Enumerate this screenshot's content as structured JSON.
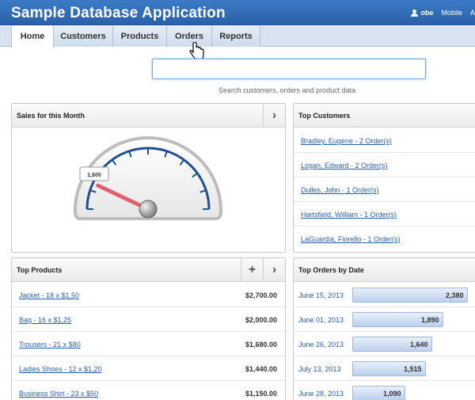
{
  "app": {
    "title": "Sample Database Application",
    "user": "obe",
    "mobile_link": "Mobile",
    "extra_link": "A"
  },
  "tabs": [
    {
      "label": "Home",
      "active": true
    },
    {
      "label": "Customers",
      "active": false
    },
    {
      "label": "Products",
      "active": false
    },
    {
      "label": "Orders",
      "active": false
    },
    {
      "label": "Reports",
      "active": false
    }
  ],
  "search": {
    "value": "",
    "hint": "Search customers, orders and product data"
  },
  "sales": {
    "title": "Sales for this Month",
    "gauge_label": "1,600",
    "gauge_fraction": 0.14,
    "colors": {
      "needle": "#e06070",
      "ticks": "#1f4f8e"
    }
  },
  "top_customers": {
    "title": "Top Customers",
    "items": [
      "Bradley, Eugene - 2 Order(s)",
      "Logan, Edward - 2 Order(s)",
      "Dulles, John - 1 Order(s)",
      "Hartsfield, William - 1 Order(s)",
      "LaGuardia, Fiorello - 1 Order(s)"
    ]
  },
  "top_products": {
    "title": "Top Products",
    "items": [
      {
        "name": "Jacket - 18 x $1,50",
        "amount": "$2,700.00"
      },
      {
        "name": "Bag - 16 x $1,25",
        "amount": "$2,000.00"
      },
      {
        "name": "Trousers - 21 x $80",
        "amount": "$1,680.00"
      },
      {
        "name": "Ladies Shoes - 12 x $1,20",
        "amount": "$1,440.00"
      },
      {
        "name": "Business Shirt - 23 x $50",
        "amount": "$1,150.00"
      }
    ]
  },
  "top_orders": {
    "title": "Top Orders by Date",
    "items": [
      {
        "date": "June 15, 2013",
        "value": "2,380",
        "fraction": 1.0
      },
      {
        "date": "June 01, 2013",
        "value": "1,890",
        "fraction": 0.79
      },
      {
        "date": "June 26, 2013",
        "value": "1,640",
        "fraction": 0.69
      },
      {
        "date": "July 13, 2013",
        "value": "1,515",
        "fraction": 0.64
      },
      {
        "date": "June 28, 2013",
        "value": "1,090",
        "fraction": 0.46
      }
    ]
  }
}
